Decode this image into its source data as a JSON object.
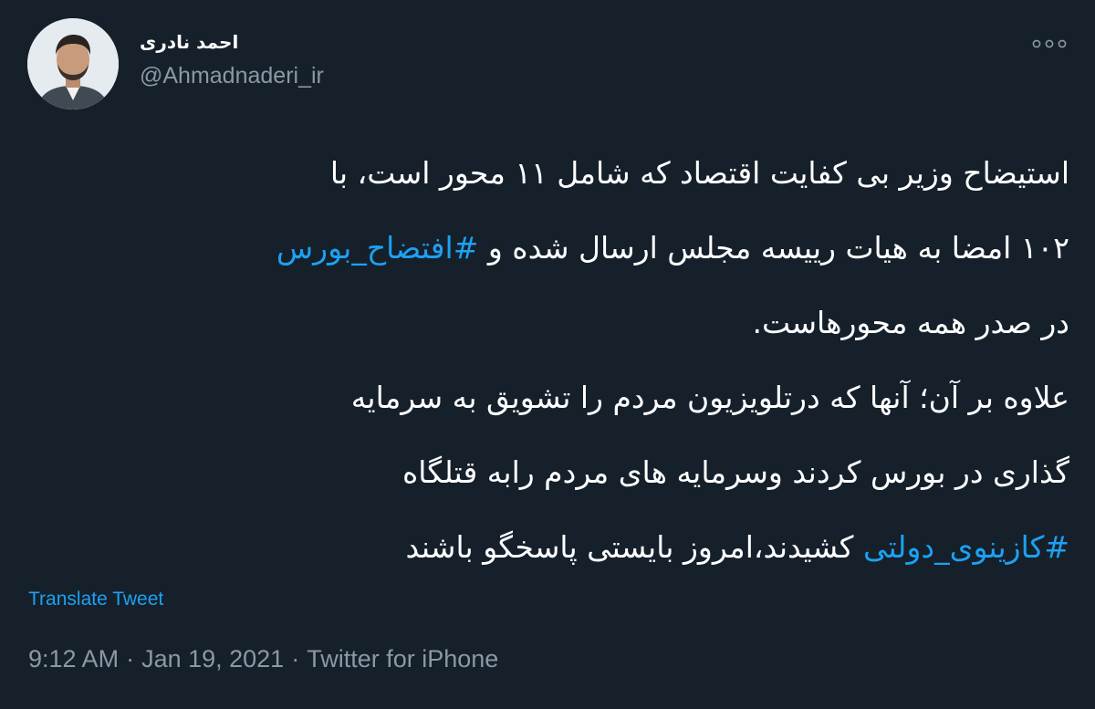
{
  "author": {
    "display_name": "احمد نادری",
    "handle": "@Ahmadnaderi_ir",
    "avatar_icon": "profile-photo"
  },
  "more_icon": "more-horizontal-icon",
  "tweet": {
    "line1": "استیضاح وزیر بی کفایت اقتصاد که شامل ۱۱ محور است، با",
    "line2_text": "۱۰۲ امضا به هیات رییسه مجلس ارسال شده و ",
    "line2_hashtag": "#افتضاح_بورس",
    "line3": "در صدر همه محورهاست.",
    "line4": "علاوه بر آن؛ آنها که درتلویزیون مردم را تشویق به سرمایه",
    "line5": "گذاری در بورس کردند وسرمایه های مردم رابه قتلگاه",
    "line6_hashtag": "#کازینوی_دولتی",
    "line6_text": " کشیدند،امروز بایستی پاسخگو باشند"
  },
  "translate_label": "Translate Tweet",
  "meta": {
    "time": "9:12 AM",
    "separator": "·",
    "date": "Jan 19, 2021",
    "source": "Twitter for iPhone"
  },
  "colors": {
    "background": "#15202b",
    "text": "#ffffff",
    "secondary": "#8b98a5",
    "accent": "#1da1f2"
  }
}
